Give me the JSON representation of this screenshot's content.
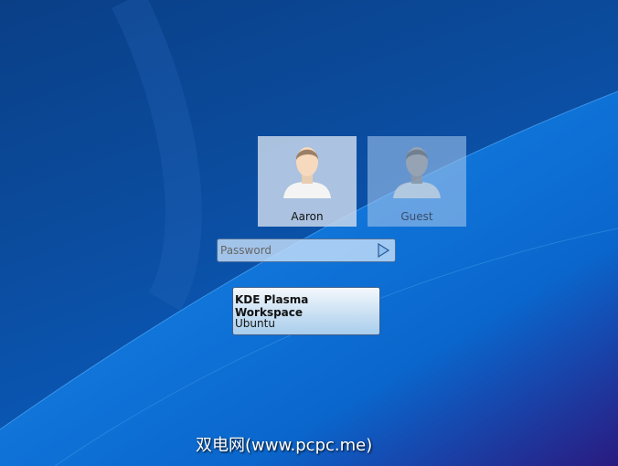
{
  "users": [
    {
      "name": "Aaron"
    },
    {
      "name": "Guest"
    }
  ],
  "password": {
    "placeholder": "Password",
    "value": ""
  },
  "session": {
    "title": "KDE Plasma Workspace",
    "selected": "Ubuntu"
  },
  "watermark": "双电网(www.pcpc.me)",
  "icons": {
    "login": "arrow-right-icon",
    "avatar": "user-avatar-icon"
  }
}
